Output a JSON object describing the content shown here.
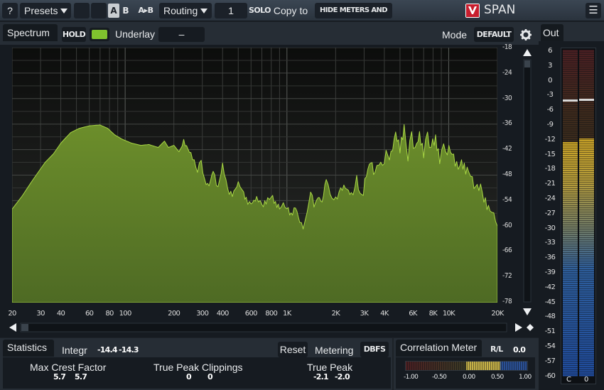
{
  "topbar": {
    "help": "?",
    "presets": "Presets",
    "ab_a": "A",
    "ab_b": "B",
    "ab_copy": "A▸B",
    "routing": "Routing",
    "channel": "1",
    "solo": "SOLO",
    "copy_to": "Copy to",
    "hide_meters": "HIDE METERS AND STATS",
    "logo_text": "SPAN",
    "menu": "☰"
  },
  "spectrum": {
    "tab": "Spectrum",
    "hold": "HOLD",
    "underlay_label": "Underlay",
    "underlay_value": "–",
    "mode_label": "Mode",
    "mode_value": "DEFAULT",
    "db_labels": [
      "-18",
      "-24",
      "-30",
      "-36",
      "-42",
      "-48",
      "-54",
      "-60",
      "-66",
      "-72",
      "-78"
    ],
    "freq_labels": [
      "20",
      "30",
      "40",
      "60",
      "80",
      "100",
      "200",
      "300",
      "400",
      "600",
      "800",
      "1K",
      "2K",
      "3K",
      "4K",
      "6K",
      "8K",
      "10K",
      "20K"
    ],
    "accent_color": "#6fa82a"
  },
  "out": {
    "tab": "Out",
    "scale": [
      "6",
      "3",
      "0",
      "-3",
      "-6",
      "-9",
      "-12",
      "-15",
      "-18",
      "-21",
      "-24",
      "-27",
      "-30",
      "-33",
      "-36",
      "-39",
      "-42",
      "-45",
      "-48",
      "-51",
      "-54",
      "-57",
      "-60"
    ],
    "channels": [
      "C",
      "0"
    ]
  },
  "statistics": {
    "tab": "Statistics",
    "integr_label": "Integr",
    "integr_left": "-14.4",
    "integr_right": "-14.3",
    "reset": "Reset",
    "metering_label": "Metering",
    "metering_value": "DBFS",
    "max_crest_label": "Max Crest Factor",
    "max_crest_left": "5.7",
    "max_crest_right": "5.7",
    "tp_clip_label": "True Peak Clippings",
    "tp_clip_left": "0",
    "tp_clip_right": "0",
    "tp_label": "True Peak",
    "tp_left": "-2.1",
    "tp_right": "-2.0"
  },
  "correlation": {
    "tab": "Correlation Meter",
    "mode": "R/L",
    "value": "0.0",
    "scale": [
      "-1.00",
      "-0.50",
      "0.00",
      "0.50",
      "1.00"
    ]
  }
}
